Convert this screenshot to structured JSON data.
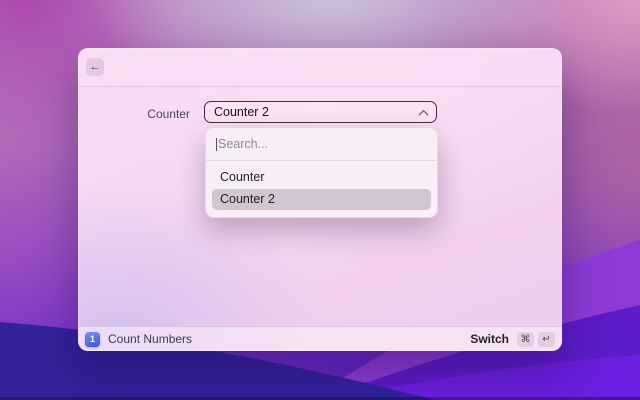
{
  "colors": {
    "option_highlight": "#d3c6d2",
    "footer_icon_blue_top": "#7e90f2",
    "footer_icon_blue_bottom": "#3c55d4",
    "select_border": "#38333e",
    "wallpaper_deep_purple": "#4c18b8"
  },
  "window": {
    "header": {
      "back_glyph": "←"
    },
    "form": {
      "field_label": "Counter",
      "dropdown_value": "Counter 2"
    },
    "dropdown_menu": {
      "search_placeholder": "Search...",
      "options": [
        {
          "label": "Counter",
          "selected": false
        },
        {
          "label": "Counter 2",
          "selected": true
        }
      ]
    },
    "footer": {
      "app_icon_text": "1",
      "command_title": "Count Numbers",
      "primary_action": {
        "label": "Switch",
        "keys": [
          "⌘",
          "↵"
        ]
      }
    }
  }
}
